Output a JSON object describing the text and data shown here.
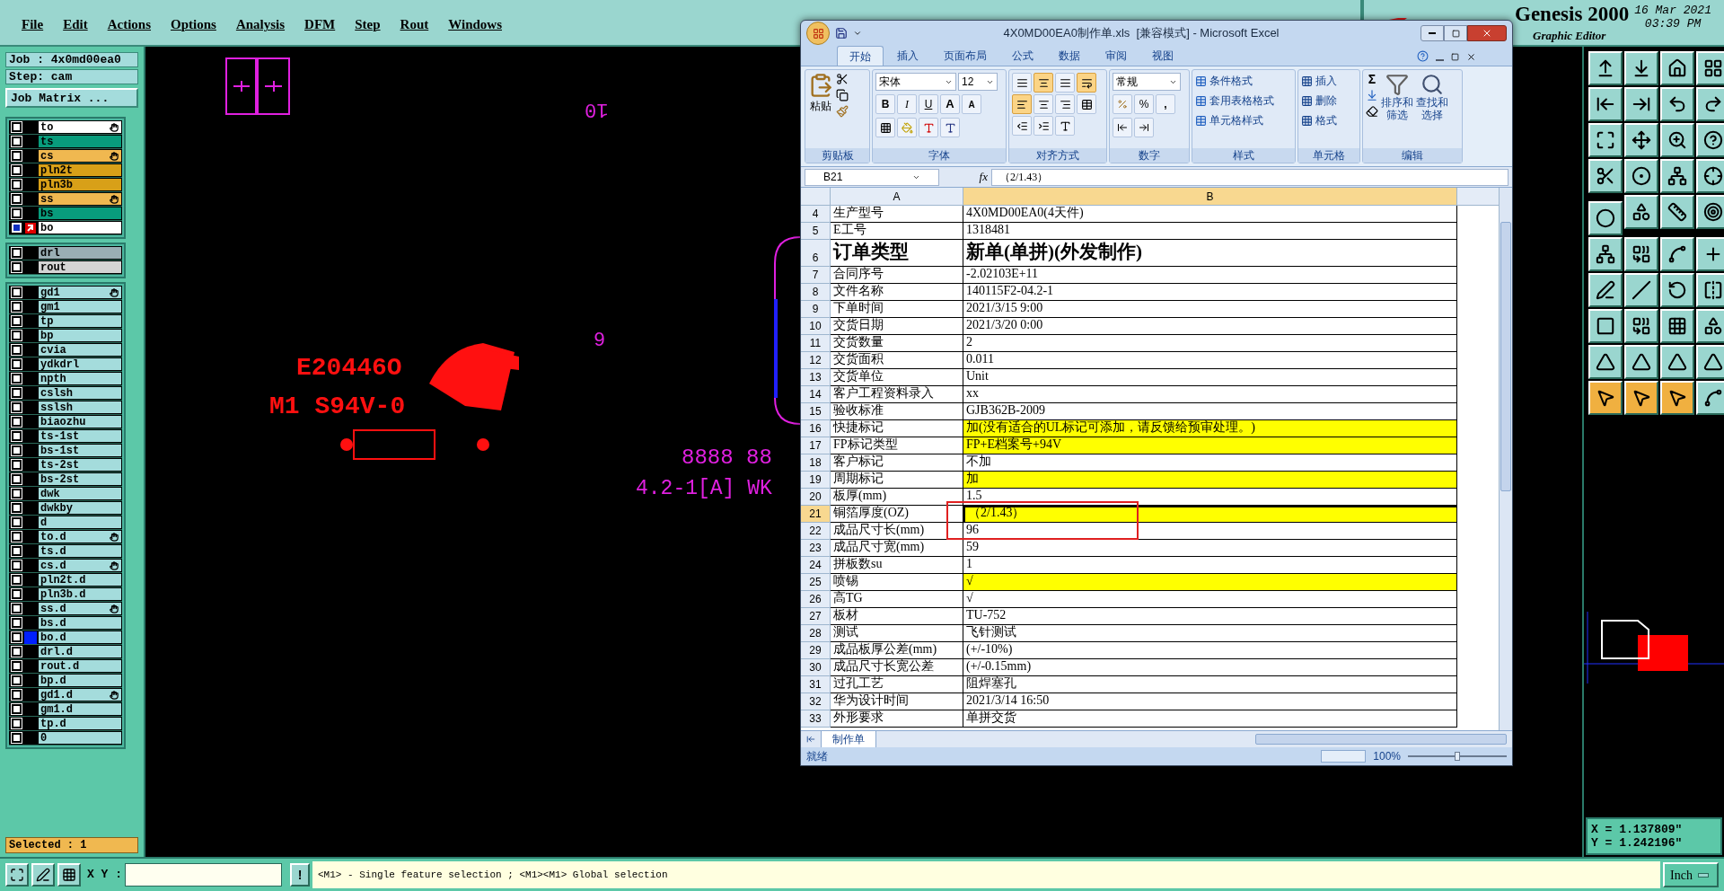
{
  "menu": [
    {
      "label": "File"
    },
    {
      "label": "Edit"
    },
    {
      "label": "Actions"
    },
    {
      "label": "Options"
    },
    {
      "label": "Analysis"
    },
    {
      "label": "DFM"
    },
    {
      "label": "Step"
    },
    {
      "label": "Rout"
    },
    {
      "label": "Windows"
    }
  ],
  "app": {
    "title": "Genesis 2000",
    "subtitle": "Graphic Editor",
    "date": "16 Mar 2021",
    "time": "03:39 PM"
  },
  "job": {
    "job": "Job : 4x0md00ea0",
    "step": "Step: cam",
    "matrix_button": "Job Matrix ..."
  },
  "layer_groups": [
    {
      "layers": [
        {
          "name": "to",
          "color": "#ffffff",
          "flag": true,
          "work": false,
          "shown": false
        },
        {
          "name": "ts",
          "color": "#089c7c",
          "flag": false,
          "work": false,
          "shown": false
        },
        {
          "name": "cs",
          "color": "#f0b850",
          "flag": true,
          "work": false,
          "shown": false
        },
        {
          "name": "pln2t",
          "color": "#d8a018",
          "flag": false,
          "work": false,
          "shown": false
        },
        {
          "name": "pln3b",
          "color": "#d8a018",
          "flag": false,
          "work": false,
          "shown": false
        },
        {
          "name": "ss",
          "color": "#f0b850",
          "flag": true,
          "work": false,
          "shown": false
        },
        {
          "name": "bs",
          "color": "#089c7c",
          "flag": false,
          "work": false,
          "shown": false
        },
        {
          "name": "bo",
          "color": "#ffffff",
          "flag": false,
          "work": true,
          "shown": false
        }
      ]
    },
    {
      "layers": [
        {
          "name": "drl",
          "color": "#9aaeb4",
          "flag": false,
          "work": false,
          "shown": false
        },
        {
          "name": "rout",
          "color": "#d4d4d4",
          "flag": false,
          "work": false,
          "shown": false
        }
      ]
    },
    {
      "layers": [
        {
          "name": "gd1",
          "color": "#a4dcdc",
          "flag": true,
          "work": false,
          "shown": false
        },
        {
          "name": "gm1",
          "color": "#a4dcdc",
          "flag": false,
          "work": false,
          "shown": false
        },
        {
          "name": "tp",
          "color": "#a4dcdc",
          "flag": false,
          "work": false,
          "shown": false
        },
        {
          "name": "bp",
          "color": "#a4dcdc",
          "flag": false,
          "work": false,
          "shown": false
        },
        {
          "name": "cvia",
          "color": "#a4dcdc",
          "flag": false,
          "work": false,
          "shown": false
        },
        {
          "name": "ydkdrl",
          "color": "#a4dcdc",
          "flag": false,
          "work": false,
          "shown": false
        },
        {
          "name": "npth",
          "color": "#a4dcdc",
          "flag": false,
          "work": false,
          "shown": false
        },
        {
          "name": "cslsh",
          "color": "#a4dcdc",
          "flag": false,
          "work": false,
          "shown": false
        },
        {
          "name": "sslsh",
          "color": "#a4dcdc",
          "flag": false,
          "work": false,
          "shown": false
        },
        {
          "name": "biaozhu",
          "color": "#a4dcdc",
          "flag": false,
          "work": false,
          "shown": false
        },
        {
          "name": "ts-1st",
          "color": "#a4dcdc",
          "flag": false,
          "work": false,
          "shown": false
        },
        {
          "name": "bs-1st",
          "color": "#a4dcdc",
          "flag": false,
          "work": false,
          "shown": false
        },
        {
          "name": "ts-2st",
          "color": "#a4dcdc",
          "flag": false,
          "work": false,
          "shown": false
        },
        {
          "name": "bs-2st",
          "color": "#a4dcdc",
          "flag": false,
          "work": false,
          "shown": false
        },
        {
          "name": "dwk",
          "color": "#a4dcdc",
          "flag": false,
          "work": false,
          "shown": false
        },
        {
          "name": "dwkby",
          "color": "#a4dcdc",
          "flag": false,
          "work": false,
          "shown": false
        },
        {
          "name": "d",
          "color": "#a4dcdc",
          "flag": false,
          "work": false,
          "shown": false
        },
        {
          "name": "to.d",
          "color": "#a4dcdc",
          "flag": true,
          "work": false,
          "shown": false
        },
        {
          "name": "ts.d",
          "color": "#a4dcdc",
          "flag": false,
          "work": false,
          "shown": false
        },
        {
          "name": "cs.d",
          "color": "#a4dcdc",
          "flag": true,
          "work": false,
          "shown": false
        },
        {
          "name": "pln2t.d",
          "color": "#a4dcdc",
          "flag": false,
          "work": false,
          "shown": false
        },
        {
          "name": "pln3b.d",
          "color": "#a4dcdc",
          "flag": false,
          "work": false,
          "shown": false
        },
        {
          "name": "ss.d",
          "color": "#a4dcdc",
          "flag": true,
          "work": false,
          "shown": false
        },
        {
          "name": "bs.d",
          "color": "#a4dcdc",
          "flag": false,
          "work": false,
          "shown": false
        },
        {
          "name": "bo.d",
          "color": "#a4dcdc",
          "flag": false,
          "work": false,
          "shown": true
        },
        {
          "name": "drl.d",
          "color": "#a4dcdc",
          "flag": false,
          "work": false,
          "shown": false
        },
        {
          "name": "rout.d",
          "color": "#a4dcdc",
          "flag": false,
          "work": false,
          "shown": false
        },
        {
          "name": "bp.d",
          "color": "#a4dcdc",
          "flag": false,
          "work": false,
          "shown": false
        },
        {
          "name": "gd1.d",
          "color": "#a4dcdc",
          "flag": true,
          "work": false,
          "shown": false
        },
        {
          "name": "gm1.d",
          "color": "#a4dcdc",
          "flag": false,
          "work": false,
          "shown": false
        },
        {
          "name": "tp.d",
          "color": "#a4dcdc",
          "flag": false,
          "work": false,
          "shown": false
        },
        {
          "name": "0",
          "color": "#a4dcdc",
          "flag": false,
          "work": false,
          "shown": false
        }
      ]
    }
  ],
  "selected_count": "Selected : 1",
  "canvas": {
    "labels": [
      {
        "text": "10",
        "color": "#e020e0"
      },
      {
        "text": "6",
        "color": "#e020e0"
      },
      {
        "text": "E20446O",
        "color": "#ff1010"
      },
      {
        "text": "M1 S94V-0",
        "color": "#ff1010"
      },
      {
        "text": "8888 88",
        "color": "#e020e0"
      },
      {
        "text": "4.2-1[A] WK",
        "color": "#e020e0"
      }
    ]
  },
  "toolbar": {
    "tools": [
      {
        "active": false
      },
      {
        "active": false
      },
      {
        "active": false
      },
      {
        "active": false
      },
      {
        "active": false
      },
      {
        "active": false
      },
      {
        "active": false
      },
      {
        "active": false
      },
      {
        "active": false
      },
      {
        "active": false
      },
      {
        "active": false
      },
      {
        "active": false
      },
      {
        "active": false
      },
      {
        "active": false
      },
      {
        "active": false
      },
      {
        "active": false
      },
      {
        "active": false
      },
      {
        "active": false
      },
      {
        "active": false
      },
      {
        "active": false
      },
      {
        "active": false
      },
      {
        "active": false
      },
      {
        "active": false
      },
      {
        "active": false
      },
      {
        "active": false
      },
      {
        "active": false
      },
      {
        "active": false
      },
      {
        "active": false
      },
      {
        "active": false
      },
      {
        "active": false
      },
      {
        "active": false
      },
      {
        "active": false
      },
      {
        "active": false
      },
      {
        "active": false
      },
      {
        "active": false
      },
      {
        "active": false
      },
      {
        "active": true
      },
      {
        "active": true
      },
      {
        "active": true
      },
      {
        "active": false
      }
    ]
  },
  "coords": {
    "x": "X = 1.137809\"",
    "y": "Y = 1.242196\""
  },
  "bottom": {
    "xy_label": "X Y :",
    "bang": "!",
    "message": "<M1> - Single feature selection ; <M1><M1> Global selection",
    "units": "Inch"
  },
  "excel": {
    "title": "4X0MD00EA0制作单.xls  [兼容模式] - Microsoft Excel",
    "tabs": [
      {
        "label": "开始",
        "selected": true
      },
      {
        "label": "插入",
        "selected": false
      },
      {
        "label": "页面布局",
        "selected": false
      },
      {
        "label": "公式",
        "selected": false
      },
      {
        "label": "数据",
        "selected": false
      },
      {
        "label": "审阅",
        "selected": false
      },
      {
        "label": "视图",
        "selected": false
      }
    ],
    "clipboard": {
      "paste": "粘贴",
      "label": "剪贴板"
    },
    "font": {
      "name": "宋体",
      "size": "12",
      "bold": "B",
      "italic": "I",
      "underline": "U",
      "grow": "A",
      "shrink": "A",
      "label": "字体"
    },
    "alignment": {
      "buttons": [
        {
          "active": false
        },
        {
          "active": true
        },
        {
          "active": false
        },
        {
          "active": true
        },
        {
          "active": true
        },
        {
          "active": false
        },
        {
          "active": false
        },
        {
          "active": false
        },
        {
          "active": false
        },
        {
          "active": false
        },
        {
          "active": false
        }
      ],
      "label": "对齐方式"
    },
    "number": {
      "format": "常规",
      "percent": "%",
      "comma": ",",
      "label": "数字"
    },
    "styles": {
      "items": [
        "条件格式",
        "套用表格格式",
        "单元格样式"
      ],
      "label": "样式"
    },
    "cells": {
      "items": [
        "插入",
        "删除",
        "格式"
      ],
      "label": "单元格"
    },
    "editing": {
      "sum": "Σ",
      "sort": [
        "排序和",
        "筛选"
      ],
      "find": [
        "查找和",
        "选择"
      ],
      "label": "编辑"
    },
    "name_box": "B21",
    "fx": "fx",
    "formula": "（2/1.43）",
    "columns": [
      "A",
      "B"
    ],
    "rows": [
      {
        "num": "4",
        "a": "生产型号",
        "b": "4X0MD00EA0(4天件)",
        "highlighted": false,
        "large": false,
        "selected": false
      },
      {
        "num": "5",
        "a": "E工号",
        "b": "1318481",
        "highlighted": false,
        "large": false,
        "selected": false
      },
      {
        "num": "6",
        "a": "订单类型",
        "b": "新单(单拼)(外发制作)",
        "highlighted": false,
        "large": true,
        "selected": false
      },
      {
        "num": "7",
        "a": "合同序号",
        "b": "-2.02103E+11",
        "highlighted": false,
        "large": false,
        "selected": false
      },
      {
        "num": "8",
        "a": "文件名称",
        "b": "140115F2-04.2-1",
        "highlighted": false,
        "large": false,
        "selected": false
      },
      {
        "num": "9",
        "a": "下单时间",
        "b": "2021/3/15 9:00",
        "highlighted": false,
        "large": false,
        "selected": false
      },
      {
        "num": "10",
        "a": "交货日期",
        "b": "2021/3/20 0:00",
        "highlighted": false,
        "large": false,
        "selected": false
      },
      {
        "num": "11",
        "a": "交货数量",
        "b": "2",
        "highlighted": false,
        "large": false,
        "selected": false
      },
      {
        "num": "12",
        "a": "交货面积",
        "b": "0.011",
        "highlighted": false,
        "large": false,
        "selected": false
      },
      {
        "num": "13",
        "a": "交货单位",
        "b": "Unit",
        "highlighted": false,
        "large": false,
        "selected": false
      },
      {
        "num": "14",
        "a": "客户工程资料录入",
        "b": "xx",
        "highlighted": false,
        "large": false,
        "selected": false
      },
      {
        "num": "15",
        "a": "验收标准",
        "b": "GJB362B-2009",
        "highlighted": false,
        "large": false,
        "selected": false
      },
      {
        "num": "16",
        "a": "快捷标记",
        "b": "加(没有适合的UL标记可添加，请反馈给预审处理。)",
        "highlighted": true,
        "large": false,
        "selected": false
      },
      {
        "num": "17",
        "a": "FP标记类型",
        "b": "FP+E档案号+94V",
        "highlighted": true,
        "large": false,
        "selected": false
      },
      {
        "num": "18",
        "a": "客户标记",
        "b": "不加",
        "highlighted": false,
        "large": false,
        "selected": false
      },
      {
        "num": "19",
        "a": "周期标记",
        "b": "加",
        "highlighted": true,
        "large": false,
        "selected": false
      },
      {
        "num": "20",
        "a": "板厚(mm)",
        "b": "1.5",
        "highlighted": false,
        "large": false,
        "selected": false
      },
      {
        "num": "21",
        "a": "铜箔厚度(OZ)",
        "b": "（2/1.43）",
        "highlighted": true,
        "large": false,
        "selected": true
      },
      {
        "num": "22",
        "a": "成品尺寸长(mm)",
        "b": "96",
        "highlighted": false,
        "large": false,
        "selected": false
      },
      {
        "num": "23",
        "a": "成品尺寸宽(mm)",
        "b": "59",
        "highlighted": false,
        "large": false,
        "selected": false
      },
      {
        "num": "24",
        "a": "拼板数su",
        "b": "1",
        "highlighted": false,
        "large": false,
        "selected": false
      },
      {
        "num": "25",
        "a": "喷锡",
        "b": "√",
        "highlighted": true,
        "large": false,
        "selected": false
      },
      {
        "num": "26",
        "a": "高TG",
        "b": "√",
        "highlighted": false,
        "large": false,
        "selected": false
      },
      {
        "num": "27",
        "a": "板材",
        "b": "TU-752",
        "highlighted": false,
        "large": false,
        "selected": false
      },
      {
        "num": "28",
        "a": "测试",
        "b": "飞针测试",
        "highlighted": false,
        "large": false,
        "selected": false
      },
      {
        "num": "29",
        "a": "成品板厚公差(mm)",
        "b": "(+/-10%)",
        "highlighted": false,
        "large": false,
        "selected": false
      },
      {
        "num": "30",
        "a": "成品尺寸长宽公差",
        "b": "(+/-0.15mm)",
        "highlighted": false,
        "large": false,
        "selected": false
      },
      {
        "num": "31",
        "a": "过孔工艺",
        "b": "阻焊塞孔",
        "highlighted": false,
        "large": false,
        "selected": false
      },
      {
        "num": "32",
        "a": "华为设计时间",
        "b": "2021/3/14 16:50",
        "highlighted": false,
        "large": false,
        "selected": false
      },
      {
        "num": "33",
        "a": "外形要求",
        "b": "单拼交货",
        "highlighted": false,
        "large": false,
        "selected": false
      }
    ],
    "sheet_tab": "制作单",
    "status": "就绪",
    "zoom": "100%",
    "zoom_slider": {
      "level": 0.5
    }
  }
}
